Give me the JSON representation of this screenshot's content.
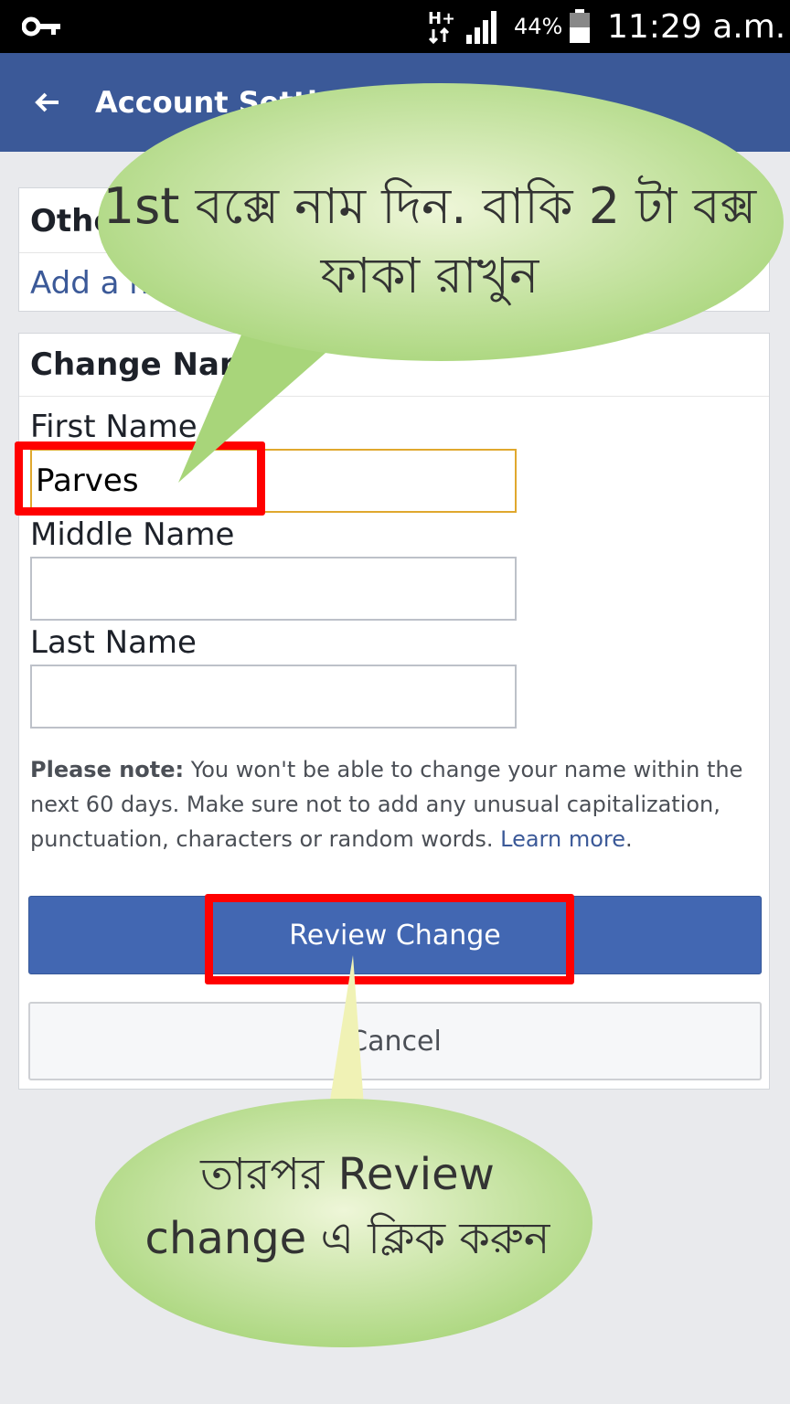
{
  "status_bar": {
    "network": "H+",
    "battery_percent": "44%",
    "time": "11:29 a.m.",
    "icons": [
      "key-icon",
      "network-type-icon",
      "signal-icon",
      "battery-icon"
    ]
  },
  "header": {
    "title": "Account Settings",
    "back_icon": "back-arrow-icon"
  },
  "other_names_card": {
    "title": "Other Names",
    "link": "Add a nickname, a birth name..."
  },
  "change_name_card": {
    "title": "Change Name",
    "first_name_label": "First Name",
    "first_name_value": "Parves",
    "middle_name_label": "Middle Name",
    "middle_name_value": "",
    "last_name_label": "Last Name",
    "last_name_value": "",
    "note_bold": "Please note:",
    "note_text": " You won't be able to change your name within the next 60 days. Make sure not to add any unusual capitalization, punctuation, characters or random words. ",
    "note_link": "Learn more",
    "note_end": ".",
    "review_button": "Review Change",
    "cancel_button": "Cancel"
  },
  "annotations": {
    "callout_top": "1st বক্সে নাম দিন. বাকি 2 টা বক্স ফাকা রাখুন",
    "callout_bottom": "তারপর Review change এ ক্লিক করুন"
  },
  "colors": {
    "header_bg": "#3b5998",
    "primary_button": "#4267b2",
    "highlight": "#ff0000",
    "callout_fill": "#b5d98a"
  }
}
